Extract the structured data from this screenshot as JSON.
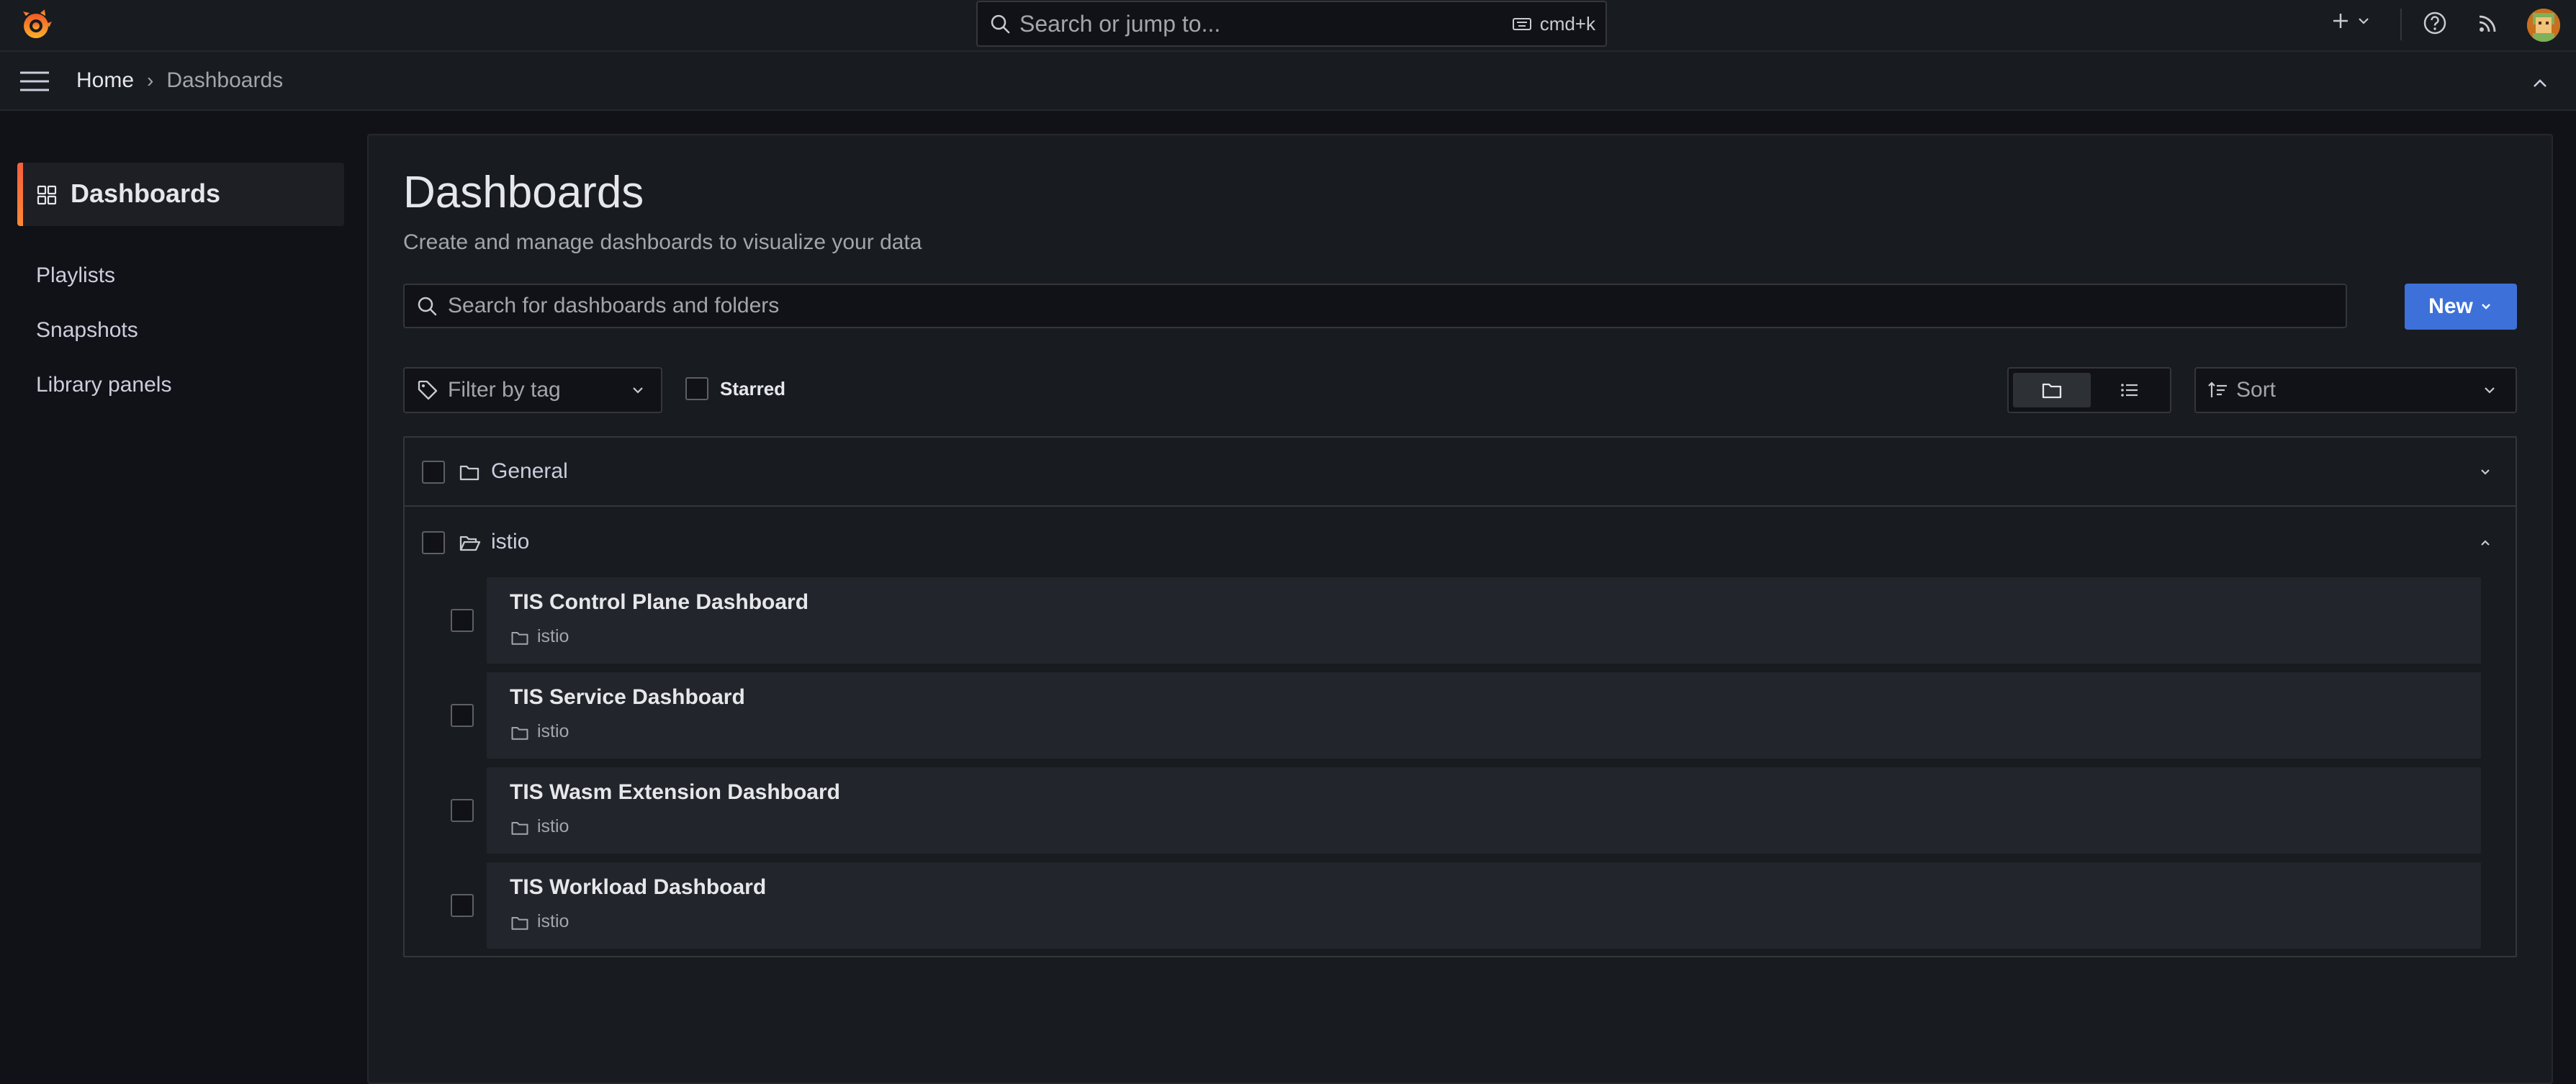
{
  "topbar": {
    "search_placeholder": "Search or jump to...",
    "shortcut": "cmd+k",
    "icons": [
      "grafana-logo-icon",
      "search-icon",
      "keyboard-icon",
      "plus-icon",
      "help-icon",
      "rss-icon",
      "avatar"
    ]
  },
  "breadcrumb": {
    "home": "Home",
    "separator": "›",
    "current": "Dashboards"
  },
  "sidebar": {
    "active_label": "Dashboards",
    "items": [
      {
        "label": "Playlists"
      },
      {
        "label": "Snapshots"
      },
      {
        "label": "Library panels"
      }
    ]
  },
  "page": {
    "title": "Dashboards",
    "subtitle": "Create and manage dashboards to visualize your data",
    "search_placeholder": "Search for dashboards and folders",
    "new_button": "New",
    "filter_by_tag": "Filter by tag",
    "starred_label": "Starred",
    "sort_label": "Sort"
  },
  "folders": [
    {
      "name": "General",
      "expanded": false
    },
    {
      "name": "istio",
      "expanded": true
    }
  ],
  "dashboards": [
    {
      "title": "TIS Control Plane Dashboard",
      "folder": "istio"
    },
    {
      "title": "TIS Service Dashboard",
      "folder": "istio"
    },
    {
      "title": "TIS Wasm Extension Dashboard",
      "folder": "istio"
    },
    {
      "title": "TIS Workload Dashboard",
      "folder": "istio"
    }
  ],
  "colors": {
    "background": "#111217",
    "panel": "#181b1f",
    "card": "#22252b",
    "primary_button": "#3d71d9",
    "active_accent": "#ff8833"
  }
}
